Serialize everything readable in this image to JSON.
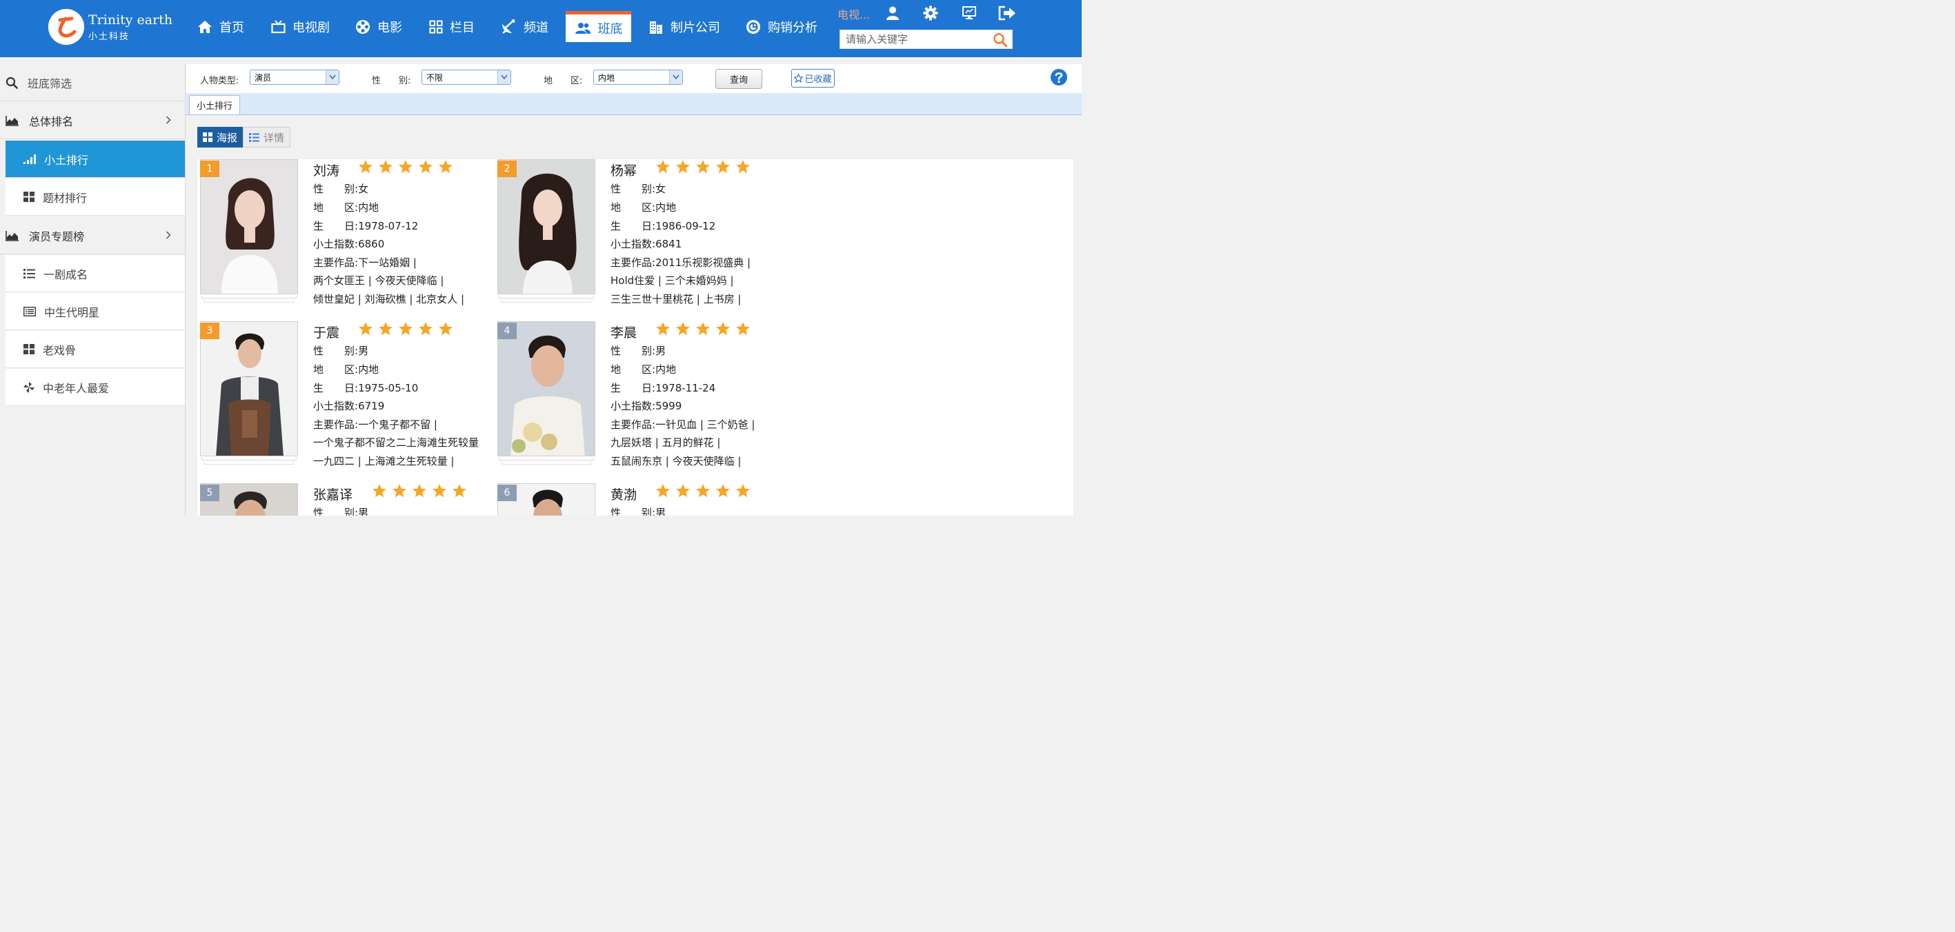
{
  "brand": {
    "en": "Trinity earth",
    "cn": "小土科技",
    "logo_char": "と"
  },
  "nav": [
    {
      "label": "首页",
      "icon": "home-icon"
    },
    {
      "label": "电视剧",
      "icon": "tv-icon"
    },
    {
      "label": "电影",
      "icon": "film-reel-icon"
    },
    {
      "label": "栏目",
      "icon": "grid-icon"
    },
    {
      "label": "频道",
      "icon": "satellite-dish-icon"
    },
    {
      "label": "班底",
      "icon": "users-icon",
      "active": true
    },
    {
      "label": "制片公司",
      "icon": "building-icon"
    },
    {
      "label": "购销分析",
      "icon": "chart-circle-icon"
    }
  ],
  "user": {
    "name": "电视..."
  },
  "search": {
    "placeholder": "请输入关键字"
  },
  "sidebar": {
    "filter_title": "班底筛选",
    "group1": "总体排名",
    "items1": [
      {
        "label": "小土排行",
        "icon": "signal-bars-icon",
        "active": true
      },
      {
        "label": "题材排行",
        "icon": "grid-icon"
      }
    ],
    "group2": "演员专题榜",
    "items2": [
      {
        "label": "一剧成名",
        "icon": "list-icon"
      },
      {
        "label": "中生代明星",
        "icon": "card-list-icon"
      },
      {
        "label": "老戏骨",
        "icon": "grid-icon"
      },
      {
        "label": "中老年人最爱",
        "icon": "pinwheel-icon"
      }
    ]
  },
  "filters": {
    "person_type_label": "人物类型:",
    "person_type_value": "演员",
    "gender_label": "性　　别:",
    "gender_value": "不限",
    "region_label": "地　　区:",
    "region_value": "内地",
    "query_label": "查询",
    "favorite_label": "已收藏"
  },
  "tab": {
    "label": "小土排行"
  },
  "view_toggle": {
    "poster": "海报",
    "detail": "详情"
  },
  "field_labels": {
    "gender": "性　　别:",
    "region": "地　　区:",
    "birthday": "生　　日:",
    "index": "小土指数:",
    "works": "主要作品:"
  },
  "colors": {
    "topbar": "#1f76d2",
    "active_side": "#2196d6",
    "rank_top": "#f39c2a",
    "rank_other": "#8e9db3",
    "star": "#f5a623"
  },
  "people": [
    {
      "rank": "1",
      "name": "刘涛",
      "stars": 5,
      "gender": "女",
      "region": "内地",
      "birthday": "1978-07-12",
      "index": "6860",
      "works": [
        "下一站婚姻 |",
        "两个女匪王 | 今夜天使降临 |",
        "倾世皇妃 | 刘海砍樵 | 北京女人 |"
      ]
    },
    {
      "rank": "2",
      "name": "杨幂",
      "stars": 5,
      "gender": "女",
      "region": "内地",
      "birthday": "1986-09-12",
      "index": "6841",
      "works": [
        "2011乐视影视盛典 |",
        "Hold住爱 | 三个未婚妈妈 |",
        "三生三世十里桃花 | 上书房 |"
      ]
    },
    {
      "rank": "3",
      "name": "于震",
      "stars": 5,
      "gender": "男",
      "region": "内地",
      "birthday": "1975-05-10",
      "index": "6719",
      "works": [
        "一个鬼子都不留 |",
        "一个鬼子都不留之二上海滩生死较量",
        "一九四二 | 上海滩之生死较量 |"
      ]
    },
    {
      "rank": "4",
      "name": "李晨",
      "stars": 5,
      "gender": "男",
      "region": "内地",
      "birthday": "1978-11-24",
      "index": "5999",
      "works": [
        "一针见血 | 三个奶爸 |",
        "九层妖塔 | 五月的鲜花 |",
        "五鼠闹东京 | 今夜天使降临 |"
      ]
    },
    {
      "rank": "5",
      "name": "张嘉译",
      "stars": 5,
      "gender": "男"
    },
    {
      "rank": "6",
      "name": "黄渤",
      "stars": 5,
      "gender": "男"
    }
  ]
}
